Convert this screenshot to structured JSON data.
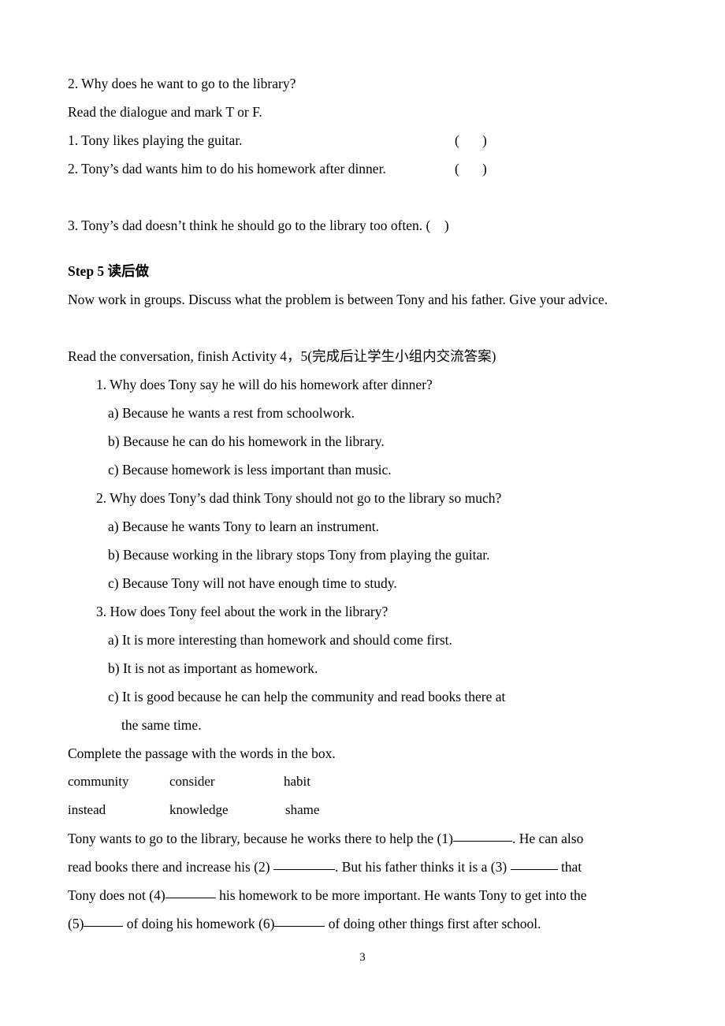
{
  "document": {
    "page_number": "3",
    "lines": {
      "q2_prev": "2. Why does he want to go to the library?",
      "read_dialogue": "Read the dialogue and mark T or F.",
      "tf_items": [
        {
          "text": "1. Tony likes playing the guitar.",
          "open": "(",
          "close": ")"
        },
        {
          "text": "2. Tony’s dad wants him to do his homework after dinner.",
          "open": "(",
          "close": ")"
        },
        {
          "text": "3. Tony’s dad doesn’t think he should go to the library too often. (",
          "close": ")"
        }
      ],
      "step5_heading": "Step 5 读后做",
      "groups_instruction": "Now work in groups. Discuss what the problem is between Tony and his father. Give your advice.",
      "read_conversation": "Read the conversation, finish Activity 4，5(完成后让学生小组内交流答案)",
      "complete_passage": "Complete the passage with the words in the box."
    },
    "questions": [
      {
        "stem": "1. Why does Tony say he will do his homework after dinner?",
        "options": [
          "a) Because he wants a rest from schoolwork.",
          "b) Because he can do his homework in the library.",
          "c) Because homework is less important than music."
        ]
      },
      {
        "stem": "2. Why does Tony’s dad think Tony should not go to the library so much?",
        "options": [
          "a) Because he wants Tony to learn an instrument.",
          "b) Because working in the library stops Tony from playing the guitar.",
          "c) Because Tony will not have enough time to study."
        ]
      },
      {
        "stem": "3. How does Tony feel about the work in the library?",
        "options": [
          "a) It is more interesting than homework and should come first.",
          "b) It is not as important as homework."
        ],
        "option_c_line1": "c) It is good because he can help the community and read books there at",
        "option_c_line2": "the same time."
      }
    ],
    "word_box": {
      "row1": [
        "community",
        "consider",
        "habit"
      ],
      "row2": [
        "instead",
        "knowledge",
        "shame"
      ]
    },
    "passage": {
      "l1_a": "Tony wants to go to the library, because he works there to help the (1)",
      "l1_b": ". He can also",
      "l2_a": "read books there and increase his (2) ",
      "l2_b": ". But his father thinks it is a (3) ",
      "l2_c": " that",
      "l3_a": "Tony does not (4)",
      "l3_b": " his homework to be more important. He wants Tony to get into the",
      "l4_a": "(5)",
      "l4_b": " of doing his homework (6)",
      "l4_c": " of doing other things first after school."
    }
  }
}
